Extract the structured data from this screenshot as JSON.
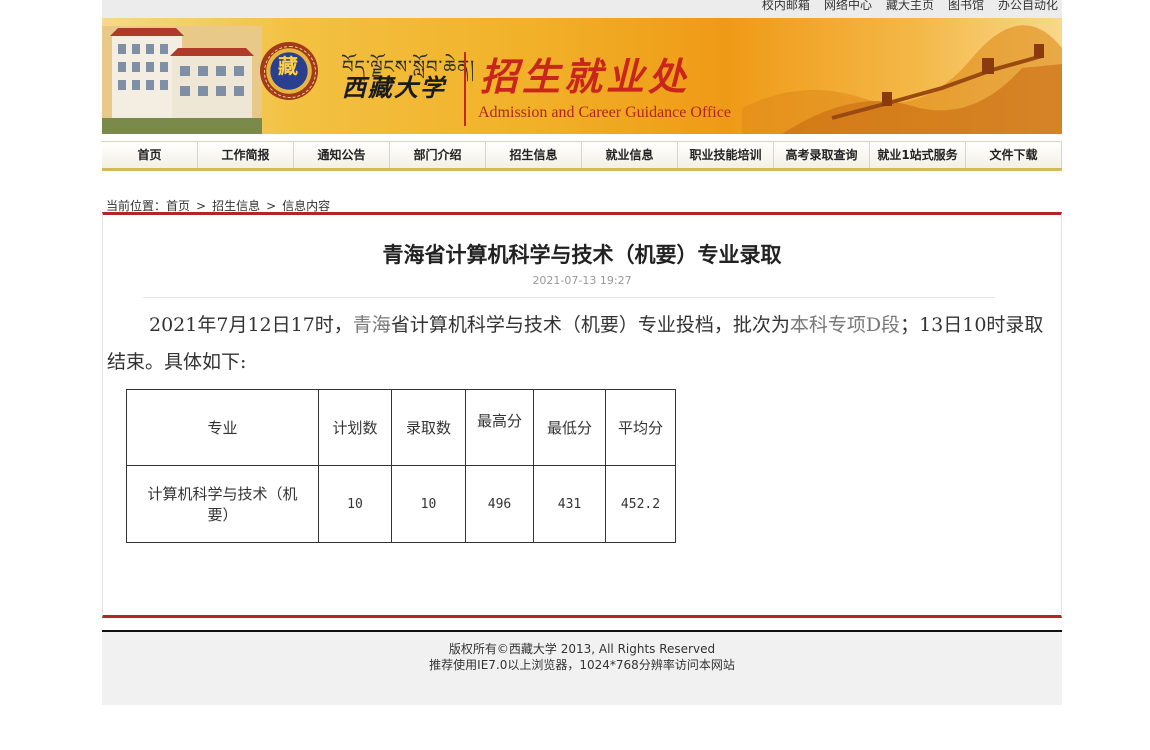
{
  "top_links": [
    "校内邮箱",
    "网络中心",
    "藏大主页",
    "图书馆",
    "办公自动化"
  ],
  "banner": {
    "seal_glyph": "藏",
    "tibetan_text": "བོད་ལྗོངས་སློབ་ཆེན།",
    "university": "西藏大学",
    "office_cn": "招生就业处",
    "office_en": "Admission and Career Guidance Office"
  },
  "nav": [
    "首页",
    "工作简报",
    "通知公告",
    "部门介绍",
    "招生信息",
    "就业信息",
    "职业技能培训",
    "高考录取查询",
    "就业1站式服务",
    "文件下载"
  ],
  "breadcrumb": {
    "prefix": "当前位置：",
    "items": [
      "首页",
      "招生信息",
      "信息内容"
    ],
    "separator": ">"
  },
  "article": {
    "title": "青海省计算机科学与技术（机要）专业录取",
    "date": "2021-07-13 19:27",
    "para": {
      "p1": "2021年7月12日17时，",
      "p2": "青海",
      "p3": "省计算机科学与技术（机要）专业投档，批次为",
      "p4": "本科专项D段",
      "p5": "；13日10时录取结束。具体如下:"
    },
    "table": {
      "headers": [
        "专业",
        "计划数",
        "录取数",
        "最高分",
        "最低分",
        "平均分"
      ],
      "row": [
        "计算机科学与技术（机要）",
        "10",
        "10",
        "496",
        "431",
        "452.2"
      ]
    }
  },
  "footer": {
    "line1": "版权所有©西藏大学 2013, All Rights Reserved",
    "line2": "推荐使用IE7.0以上浏览器，1024*768分辨率访问本网站"
  },
  "colors": {
    "accent_red": "#b2262a",
    "banner_orange": "#f1b128",
    "nav_gold": "#d6b85a"
  }
}
